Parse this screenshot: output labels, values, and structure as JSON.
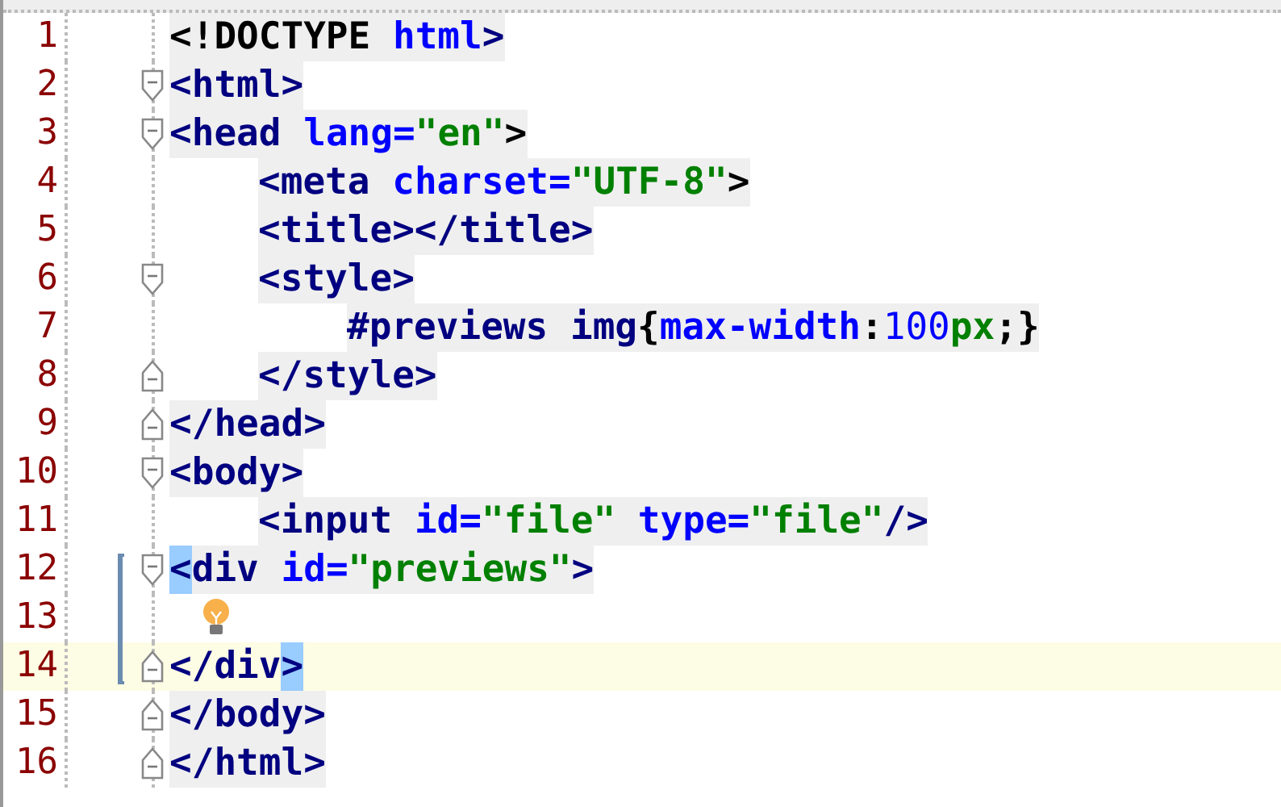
{
  "editor": {
    "lines": [
      {
        "number": "1",
        "fold_start": false,
        "fold_end": false,
        "scoped": false,
        "hint": false,
        "current": false,
        "tokens": [
          {
            "kind": "plain",
            "text": "<!DOCTYPE "
          },
          {
            "kind": "attr",
            "text": "html"
          },
          {
            "kind": "tag",
            "text": ">"
          }
        ]
      },
      {
        "number": "2",
        "fold_start": true,
        "fold_end": false,
        "scoped": false,
        "hint": false,
        "current": false,
        "tokens": [
          {
            "kind": "tag",
            "text": "<html>"
          }
        ]
      },
      {
        "number": "3",
        "fold_start": true,
        "fold_end": false,
        "scoped": false,
        "hint": false,
        "current": false,
        "tokens": [
          {
            "kind": "tag",
            "text": "<head "
          },
          {
            "kind": "attr",
            "text": "lang="
          },
          {
            "kind": "value",
            "text": "\"en\""
          },
          {
            "kind": "plain",
            "text": ">"
          }
        ],
        "children": [
          {
            "number": "4",
            "fold_start": false,
            "fold_end": false,
            "scoped": false,
            "hint": false,
            "current": false,
            "tokens": [
              {
                "kind": "tag",
                "text": "<meta "
              },
              {
                "kind": "attr",
                "text": "charset="
              },
              {
                "kind": "value",
                "text": "\"UTF-8\""
              },
              {
                "kind": "plain",
                "text": ">"
              }
            ]
          },
          {
            "number": "5",
            "fold_start": false,
            "fold_end": false,
            "scoped": false,
            "hint": false,
            "current": false,
            "tokens": [
              {
                "kind": "tag",
                "text": "<title></title>"
              }
            ]
          },
          {
            "number": "6",
            "fold_start": true,
            "fold_end": false,
            "scoped": false,
            "hint": false,
            "current": false,
            "tokens": [
              {
                "kind": "tag",
                "text": "<style>"
              }
            ],
            "children": [
              {
                "number": "7",
                "fold_start": false,
                "fold_end": false,
                "scoped": false,
                "hint": false,
                "current": false,
                "tokens": [
                  {
                    "kind": "tag",
                    "text": "#previews img"
                  },
                  {
                    "kind": "plain",
                    "text": "{"
                  },
                  {
                    "kind": "attr",
                    "text": "max-width"
                  },
                  {
                    "kind": "plain",
                    "text": ":"
                  },
                  {
                    "kind": "num",
                    "text": "100"
                  },
                  {
                    "kind": "value",
                    "text": "px"
                  },
                  {
                    "kind": "plain",
                    "text": ";}"
                  }
                ]
              }
            ]
          },
          {
            "number": "8",
            "fold_start": false,
            "fold_end": true,
            "scoped": false,
            "hint": false,
            "current": false,
            "tokens": [
              {
                "kind": "tag",
                "text": "</style>"
              }
            ]
          }
        ]
      },
      {
        "number": "9",
        "fold_start": false,
        "fold_end": true,
        "scoped": false,
        "hint": false,
        "current": false,
        "tokens": [
          {
            "kind": "tag",
            "text": "</head>"
          }
        ]
      },
      {
        "number": "10",
        "fold_start": true,
        "fold_end": false,
        "scoped": false,
        "hint": false,
        "current": false,
        "tokens": [
          {
            "kind": "tag",
            "text": "<body>"
          }
        ],
        "children": [
          {
            "number": "11",
            "fold_start": false,
            "fold_end": false,
            "scoped": false,
            "hint": false,
            "current": false,
            "tokens": [
              {
                "kind": "tag",
                "text": "<input "
              },
              {
                "kind": "attr",
                "text": "id="
              },
              {
                "kind": "value",
                "text": "\"file\" "
              },
              {
                "kind": "attr",
                "text": "type="
              },
              {
                "kind": "value",
                "text": "\"file\""
              },
              {
                "kind": "tag",
                "text": "/>"
              }
            ]
          }
        ]
      },
      {
        "number": "12",
        "fold_start": true,
        "fold_end": false,
        "scoped": true,
        "hint": false,
        "current": false,
        "tokens": [
          {
            "kind": "match",
            "text": "<"
          },
          {
            "kind": "tag",
            "text": "div "
          },
          {
            "kind": "attr",
            "text": "id="
          },
          {
            "kind": "value",
            "text": "\"previews\""
          },
          {
            "kind": "tag",
            "text": ">"
          }
        ]
      },
      {
        "number": "13",
        "fold_start": false,
        "fold_end": false,
        "scoped": true,
        "hint": true,
        "current": false
      },
      {
        "number": "14",
        "fold_start": false,
        "fold_end": true,
        "scoped": true,
        "hint": false,
        "current": true,
        "tokens": [
          {
            "kind": "tag",
            "text": "</div"
          },
          {
            "kind": "match",
            "text": ">"
          }
        ]
      },
      {
        "number": "15",
        "fold_start": false,
        "fold_end": true,
        "scoped": false,
        "hint": false,
        "current": false,
        "tokens": [
          {
            "kind": "tag",
            "text": "</body>"
          }
        ]
      },
      {
        "number": "16",
        "fold_start": false,
        "fold_end": true,
        "scoped": false,
        "hint": false,
        "current": false,
        "tokens": [
          {
            "kind": "tag",
            "text": "</html>"
          }
        ]
      }
    ]
  }
}
